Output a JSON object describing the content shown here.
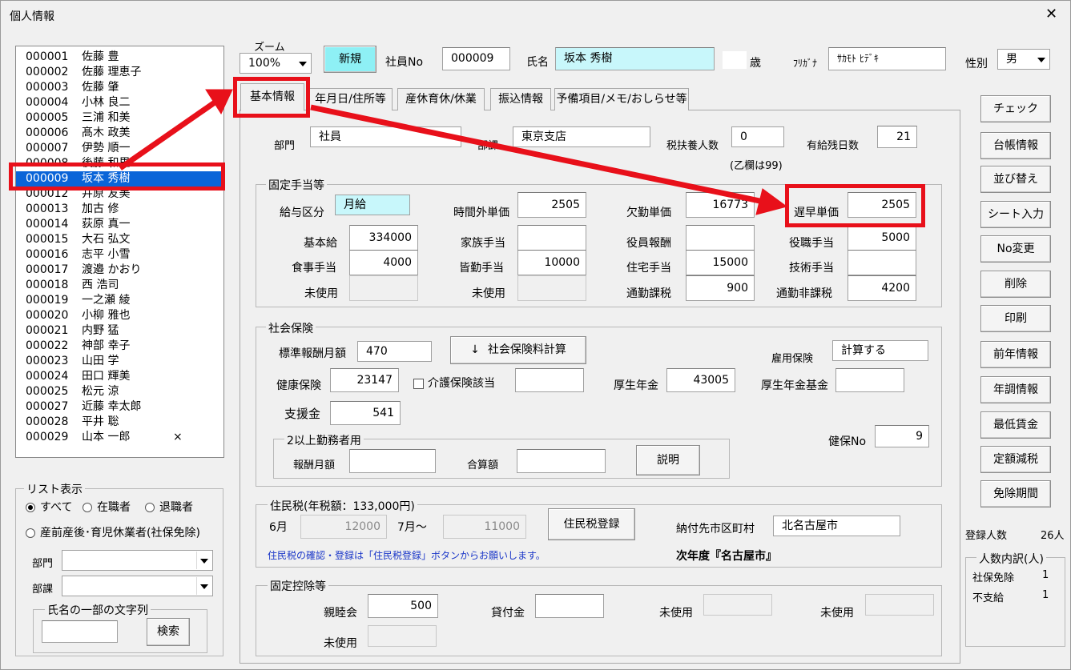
{
  "window": {
    "title": "個人情報",
    "close_glyph": "✕"
  },
  "employee_list": {
    "items": [
      {
        "no": "000001",
        "name": "佐藤 豊",
        "mark": ""
      },
      {
        "no": "000002",
        "name": "佐藤 理恵子",
        "mark": ""
      },
      {
        "no": "000003",
        "name": "佐藤 肇",
        "mark": ""
      },
      {
        "no": "000004",
        "name": "小林 良二",
        "mark": ""
      },
      {
        "no": "000005",
        "name": "三浦 和美",
        "mark": ""
      },
      {
        "no": "000006",
        "name": "髙木 政美",
        "mark": ""
      },
      {
        "no": "000007",
        "name": "伊勢 順一",
        "mark": ""
      },
      {
        "no": "000008",
        "name": "後藤 和里",
        "mark": ""
      },
      {
        "no": "000009",
        "name": "坂本 秀樹",
        "mark": ""
      },
      {
        "no": "000012",
        "name": "井原 友美",
        "mark": ""
      },
      {
        "no": "000013",
        "name": "加古 修",
        "mark": ""
      },
      {
        "no": "000014",
        "name": "荻原 真一",
        "mark": ""
      },
      {
        "no": "000015",
        "name": "大石 弘文",
        "mark": ""
      },
      {
        "no": "000016",
        "name": "志平 小雪",
        "mark": ""
      },
      {
        "no": "000017",
        "name": "渡邉 かおり",
        "mark": ""
      },
      {
        "no": "000018",
        "name": "西 浩司",
        "mark": ""
      },
      {
        "no": "000019",
        "name": "一之瀬 綾",
        "mark": ""
      },
      {
        "no": "000020",
        "name": "小柳 雅也",
        "mark": ""
      },
      {
        "no": "000021",
        "name": "内野 猛",
        "mark": ""
      },
      {
        "no": "000022",
        "name": "神部 幸子",
        "mark": ""
      },
      {
        "no": "000023",
        "name": "山田 学",
        "mark": ""
      },
      {
        "no": "000024",
        "name": "田口 輝美",
        "mark": ""
      },
      {
        "no": "000025",
        "name": "松元 涼",
        "mark": ""
      },
      {
        "no": "000027",
        "name": "近藤 幸太郎",
        "mark": ""
      },
      {
        "no": "000028",
        "name": "平井 聡",
        "mark": ""
      },
      {
        "no": "000029",
        "name": "山本 一郎",
        "mark": "×"
      }
    ]
  },
  "list_display": {
    "title": "リスト表示",
    "radio_all": "すべて",
    "radio_active": "在職者",
    "radio_retired": "退職者",
    "radio_leave": "産前産後･育児休業者(社保免除)",
    "dept_label": "部門",
    "section_label": "部課",
    "name_search_title": "氏名の一部の文字列",
    "search_button": "検索"
  },
  "header": {
    "zoom_label": "ズーム",
    "zoom_value": "100%",
    "new_button": "新規",
    "emp_no_label": "社員No",
    "emp_no_value": "000009",
    "name_label": "氏名",
    "name_value": "坂本 秀樹",
    "age_label": "歳",
    "furigana_label": "ﾌﾘｶﾞﾅ",
    "furigana_value": "ｻｶﾓﾄ ﾋﾃﾞｷ",
    "gender_label": "性別",
    "gender_value": "男"
  },
  "tabs": [
    "基本情報",
    "年月日/住所等",
    "産休育休/休業",
    "振込情報",
    "予備項目/メモ/おしらせ等"
  ],
  "basic": {
    "dept_label": "部門",
    "dept_value": "社員",
    "section_label": "部課",
    "section_value": "東京支店",
    "dependents_label": "税扶養人数",
    "dependents_value": "0",
    "dependents_note": "(乙欄は99)",
    "paid_leave_label": "有給残日数",
    "paid_leave_value": "21"
  },
  "fixed_allowance": {
    "title": "固定手当等",
    "pay_type_label": "給与区分",
    "pay_type_value": "月給",
    "overtime_label": "時間外単価",
    "overtime_value": "2505",
    "absence_label": "欠勤単価",
    "absence_value": "16773",
    "late_label": "遅早単価",
    "late_value": "2505",
    "base_label": "基本給",
    "base_value": "334000",
    "family_label": "家族手当",
    "family_value": "",
    "officer_label": "役員報酬",
    "officer_value": "",
    "position_label": "役職手当",
    "position_value": "5000",
    "meal_label": "食事手当",
    "meal_value": "4000",
    "attendance_label": "皆勤手当",
    "attendance_value": "10000",
    "housing_label": "住宅手当",
    "housing_value": "15000",
    "skill_label": "技術手当",
    "skill_value": "",
    "unused1_label": "未使用",
    "unused2_label": "未使用",
    "commute_tax_label": "通勤課税",
    "commute_tax_value": "900",
    "commute_nontax_label": "通勤非課税",
    "commute_nontax_value": "4200"
  },
  "social_insurance": {
    "title": "社会保険",
    "std_monthly_label": "標準報酬月額",
    "std_monthly_value": "470",
    "calc_button": "社会保険料計算",
    "calc_arrow": "↓",
    "employment_label": "雇用保険",
    "employment_value": "計算する",
    "health_label": "健康保険",
    "health_value": "23147",
    "care_label": "介護保険該当",
    "care_value": "",
    "pension_label": "厚生年金",
    "pension_value": "43005",
    "pension_fund_label": "厚生年金基金",
    "pension_fund_value": "",
    "support_label": "支援金",
    "support_value": "541",
    "health_no_label": "健保No",
    "health_no_value": "9",
    "multi_title": "2以上勤務者用",
    "multi_pay_label": "報酬月額",
    "multi_total_label": "合算額",
    "explain_button": "説明"
  },
  "resident_tax": {
    "title": "住民税(年税額：133,000円)",
    "june_label": "6月",
    "june_value": "12000",
    "july_label": "7月～",
    "july_value": "11000",
    "register_button": "住民税登録",
    "municipality_label": "納付先市区町村",
    "municipality_value": "北名古屋市",
    "note": "住民税の確認・登録は「住民税登録」ボタンからお願いします。",
    "next_year": "次年度『名古屋市』"
  },
  "fixed_deduction": {
    "title": "固定控除等",
    "social_label": "親睦会",
    "social_value": "500",
    "loan_label": "貸付金",
    "loan_value": "",
    "unused1_label": "未使用",
    "unused2_label": "未使用",
    "unused3_label": "未使用"
  },
  "side_buttons": [
    "チェック",
    "台帳情報",
    "並び替え",
    "シート入力",
    "No変更",
    "削除",
    "印刷",
    "前年情報",
    "年調情報",
    "最低賃金",
    "定額減税",
    "免除期間"
  ],
  "stats": {
    "registered_label": "登録人数",
    "registered_value": "26人",
    "breakdown_title": "人数内訳(人)",
    "exempt_label": "社保免除",
    "exempt_value": "1",
    "unpaid_label": "不支給",
    "unpaid_value": "1"
  },
  "colors": {
    "selection": "#0a64d8",
    "highlight_red": "#e8101a",
    "name_field_bg": "#c8f7fb",
    "new_button_bg": "#8ef0f5"
  }
}
